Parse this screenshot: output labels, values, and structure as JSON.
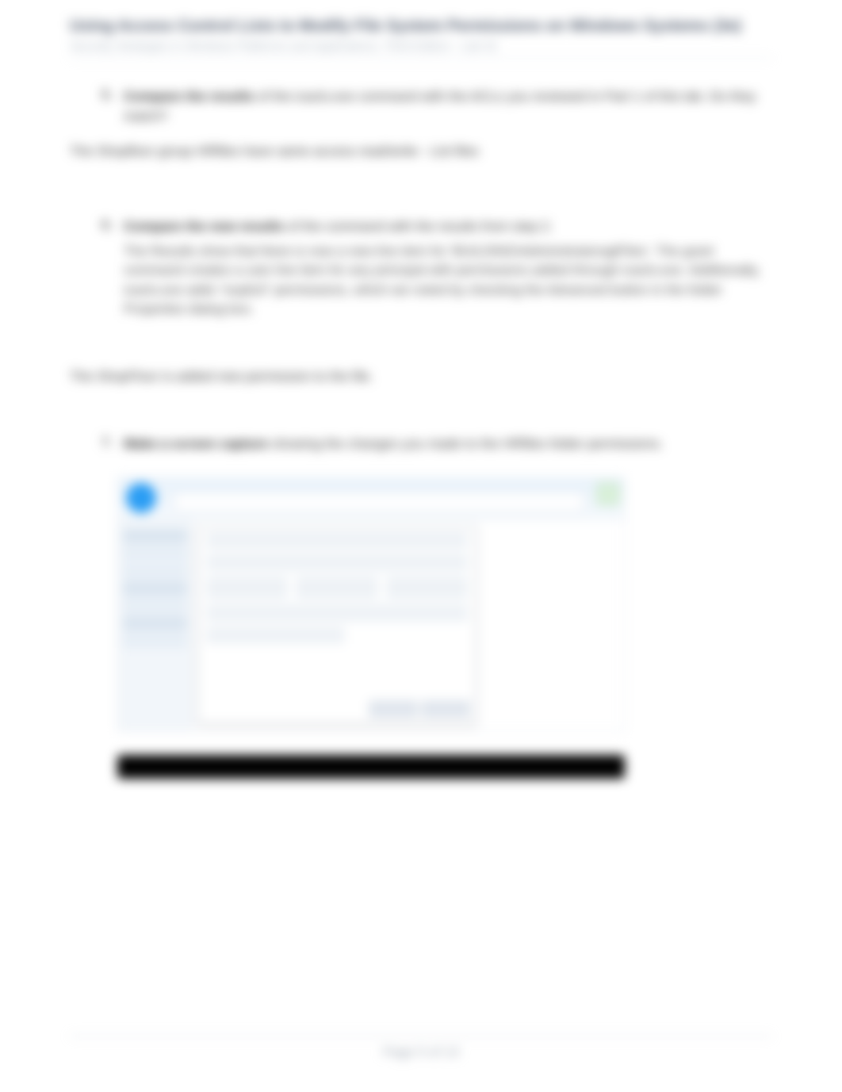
{
  "header": {
    "title": "Using Access Control Lists to Modify File System Permissions on Windows Systems (3e)",
    "subtitle": "Security Strategies in Windows Platforms and Applications, Third Edition - Lab 02"
  },
  "item5": {
    "bold": "Compare the results",
    "rest": " of the icacls.exe command with the ACLs you reviewed in Part 1 of this lab. Do they match?"
  },
  "para1": "The Shopfloor group HRfiles have same access read/write - List files",
  "item6": {
    "bold": "Compare the new results",
    "rest": " of the command with the results from step 2."
  },
  "explain6": "The Results show that there is now a new line item for 'BUILDING\\AdministratorsgtFiles'. The grant command creates a user line item for any principal with permissions added through icacls.exe. Additionally, icacls.exe adds \"explicit\" permissions, which we noted by checking the Advanced button in the folder Properties dialog box.",
  "para2": "The ShopFloor is added new permission to the file.",
  "item7": {
    "bold": "Make a screen capture",
    "rest": " showing the changes you made to the HRfiles folder permissions."
  },
  "footer": "Page 5 of 13"
}
